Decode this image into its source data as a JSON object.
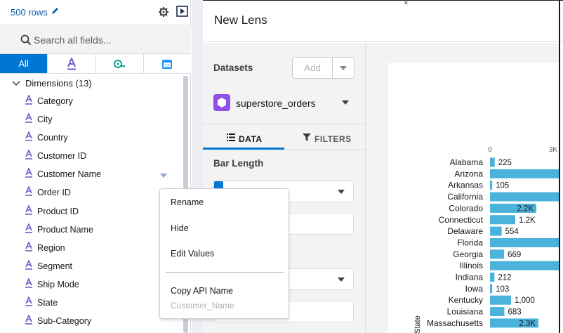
{
  "left_panel": {
    "rows_label": "500 rows",
    "search_placeholder": "Search all fields...",
    "tabs": [
      {
        "label": "All",
        "active": true
      },
      {
        "label": "",
        "icon": "text-field-icon",
        "active": false
      },
      {
        "label": "",
        "icon": "measure-icon",
        "active": false
      },
      {
        "label": "",
        "icon": "date-field-icon",
        "active": false
      }
    ],
    "dimensions_title": "Dimensions (13)",
    "fields": [
      "Category",
      "City",
      "Country",
      "Customer ID",
      "Customer Name",
      "Order ID",
      "Product ID",
      "Product Name",
      "Region",
      "Segment",
      "Ship Mode",
      "State",
      "Sub-Category"
    ]
  },
  "header": {
    "title": "New Lens"
  },
  "config": {
    "datasets_label": "Datasets",
    "add_label": "Add",
    "dataset_name": "superstore_orders",
    "tabs": [
      {
        "label": "DATA",
        "icon": "list-icon",
        "active": true
      },
      {
        "label": "FILTERS",
        "icon": "filter-icon",
        "active": false
      }
    ],
    "bar_length_label": "Bar Length"
  },
  "context_menu": {
    "items": [
      "Rename",
      "Hide",
      "Edit Values",
      "Copy API Name"
    ],
    "api_name_value": "Customer_Name"
  },
  "colors": {
    "accent": "#0176d3",
    "bar": "#4bb2db",
    "dataset_icon": "#9050e9",
    "field_icon": "#6b5ec9",
    "measure_icon": "#06a59a",
    "date_icon": "#1b96ff"
  },
  "chart_data": {
    "type": "bar",
    "orientation": "horizontal",
    "ylabel": "State",
    "x_ticks": [
      "0",
      "3K"
    ],
    "x_tick_values": [
      0,
      3000
    ],
    "categories": [
      "Alabama",
      "Arizona",
      "Arkansas",
      "California",
      "Colorado",
      "Connecticut",
      "Delaware",
      "Florida",
      "Georgia",
      "Illinois",
      "Indiana",
      "Iowa",
      "Kentucky",
      "Louisiana",
      "Massachusetts"
    ],
    "values": [
      225,
      null,
      105,
      null,
      2200,
      1200,
      554,
      null,
      669,
      null,
      212,
      103,
      1000,
      683,
      2300
    ],
    "data_labels": [
      "225",
      "",
      "105",
      "",
      "2.2K",
      "1.2K",
      "554",
      "",
      "669",
      "",
      "212",
      "103",
      "1,000",
      "683",
      "2.3K"
    ],
    "note_truncated": "bars for Arizona, California, Florida and Illinois extend beyond visible area"
  }
}
